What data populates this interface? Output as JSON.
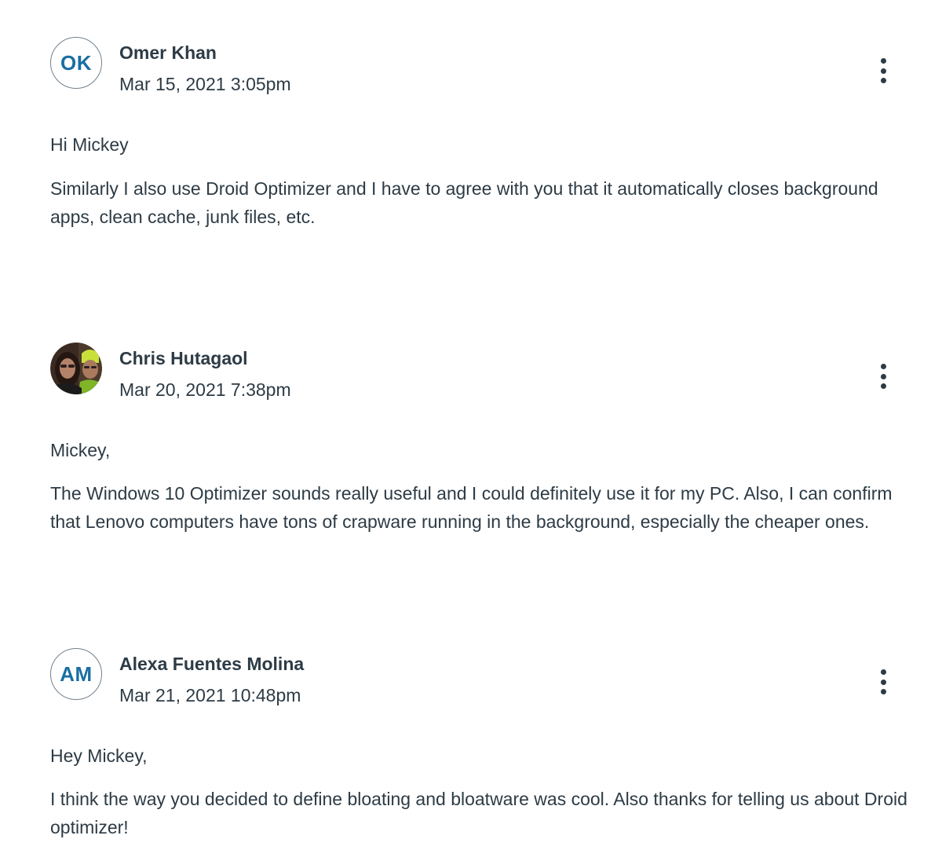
{
  "posts": [
    {
      "avatar_initials": "OK",
      "author": "Omer Khan",
      "timestamp": "Mar 15, 2021 3:05pm",
      "greeting": "Hi Mickey",
      "body": "Similarly I also use Droid Optimizer and I have to agree with you that it automatically closes background apps, clean cache, junk files, etc."
    },
    {
      "avatar_initials": "",
      "author": "Chris Hutagaol",
      "timestamp": "Mar 20, 2021 7:38pm",
      "greeting": "Mickey,",
      "body": "The Windows 10 Optimizer sounds really useful and I could definitely use it for my PC. Also, I can confirm that Lenovo computers have tons of crapware running in the background, especially the cheaper ones."
    },
    {
      "avatar_initials": "AM",
      "author": "Alexa Fuentes Molina",
      "timestamp": "Mar 21, 2021 10:48pm",
      "greeting": "Hey Mickey,",
      "body": "I think the way you decided to define bloating and bloatware was cool. Also thanks for telling us about Droid optimizer!"
    }
  ],
  "icons": {
    "menu": "more-vertical-icon"
  },
  "colors": {
    "text": "#2d3b45",
    "initials": "#1a6ea3",
    "avatar_border": "#73818c"
  }
}
